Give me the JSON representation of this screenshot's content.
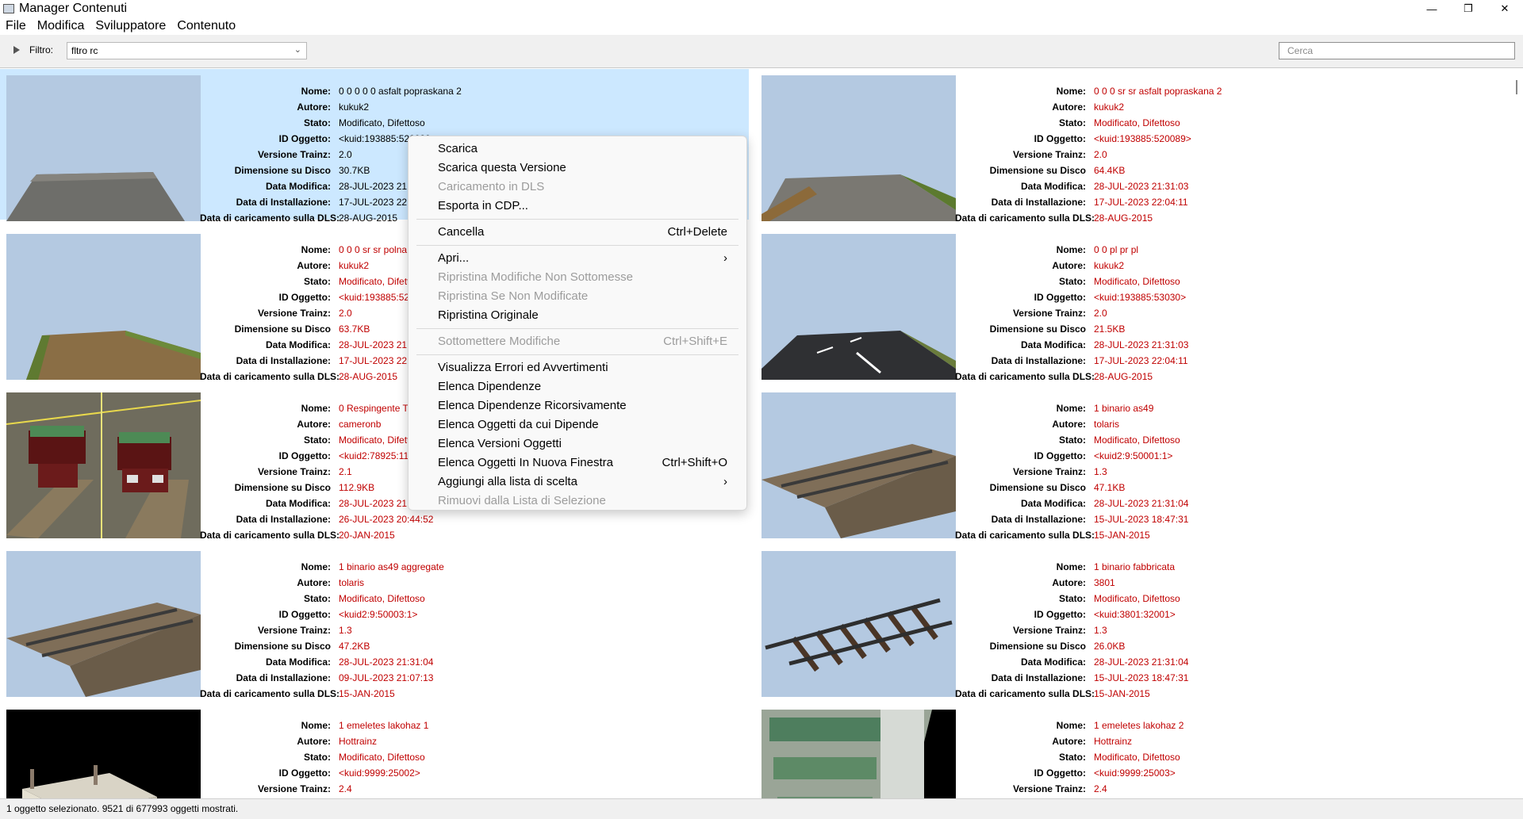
{
  "window": {
    "title": "Manager Contenuti",
    "min_label": "—",
    "max_label": "❐",
    "close_label": "✕"
  },
  "menubar": [
    "File",
    "Modifica",
    "Sviluppatore",
    "Contenuto"
  ],
  "toolbar": {
    "filter_label": "Filtro:",
    "filter_value": "fltro rc",
    "search_placeholder": "Cerca"
  },
  "labels": {
    "nome": "Nome:",
    "autore": "Autore:",
    "stato": "Stato:",
    "id": "ID Oggetto:",
    "versione": "Versione Trainz:",
    "dimensione": "Dimensione su Disco",
    "modifica": "Data Modifica:",
    "installazione": "Data di Installazione:",
    "dls": "Data di caricamento sulla DLS:"
  },
  "items": [
    {
      "nome": "0 0 0 0 0 asfalt popraskana 2",
      "autore": "kukuk2",
      "stato": "Modificato, Difettoso",
      "id": "<kuid:193885:520089>",
      "versione": "2.0",
      "dimensione": "30.7KB",
      "modifica": "28-JUL-2023 21:31:03",
      "installazione": "17-JUL-2023 22:04:11",
      "dls": "28-AUG-2015",
      "thumb": "road-gray",
      "selected": true
    },
    {
      "nome": "0 0 0 sr sr asfalt popraskana 2",
      "autore": "kukuk2",
      "stato": "Modificato, Difettoso",
      "id": "<kuid:193885:520089>",
      "versione": "2.0",
      "dimensione": "64.4KB",
      "modifica": "28-JUL-2023 21:31:03",
      "installazione": "17-JUL-2023 22:04:11",
      "dls": "28-AUG-2015",
      "thumb": "road-edge"
    },
    {
      "nome": "0 0 0 sr sr polna 2",
      "autore": "kukuk2",
      "stato": "Modificato, Difettoso",
      "id": "<kuid:193885:520089>",
      "versione": "2.0",
      "dimensione": "63.7KB",
      "modifica": "28-JUL-2023 21:31:03",
      "installazione": "17-JUL-2023 22:04:11",
      "dls": "28-AUG-2015",
      "thumb": "dirt"
    },
    {
      "nome": "0 0 pl pr pl",
      "autore": "kukuk2",
      "stato": "Modificato, Difettoso",
      "id": "<kuid:193885:53030>",
      "versione": "2.0",
      "dimensione": "21.5KB",
      "modifica": "28-JUL-2023 21:31:03",
      "installazione": "17-JUL-2023 22:04:11",
      "dls": "28-AUG-2015",
      "thumb": "asphalt"
    },
    {
      "nome": "0 Respingente TT",
      "autore": "cameronb",
      "stato": "Modificato, Difettoso",
      "id": "<kuid2:78925:11000:1>",
      "versione": "2.1",
      "dimensione": "112.9KB",
      "modifica": "28-JUL-2023 21:31:04",
      "installazione": "26-JUL-2023 20:44:52",
      "dls": "20-JAN-2015",
      "thumb": "wagons"
    },
    {
      "nome": "1 binario as49",
      "autore": "tolaris",
      "stato": "Modificato, Difettoso",
      "id": "<kuid2:9:50001:1>",
      "versione": "1.3",
      "dimensione": "47.1KB",
      "modifica": "28-JUL-2023 21:31:04",
      "installazione": "15-JUL-2023 18:47:31",
      "dls": "15-JAN-2015",
      "thumb": "track"
    },
    {
      "nome": "1 binario as49 aggregate",
      "autore": "tolaris",
      "stato": "Modificato, Difettoso",
      "id": "<kuid2:9:50003:1>",
      "versione": "1.3",
      "dimensione": "47.2KB",
      "modifica": "28-JUL-2023 21:31:04",
      "installazione": "09-JUL-2023 21:07:13",
      "dls": "15-JAN-2015",
      "thumb": "track"
    },
    {
      "nome": "1 binario fabbricata",
      "autore": "3801",
      "stato": "Modificato, Difettoso",
      "id": "<kuid:3801:32001>",
      "versione": "1.3",
      "dimensione": "26.0KB",
      "modifica": "28-JUL-2023 21:31:04",
      "installazione": "15-JUL-2023 18:47:31",
      "dls": "15-JAN-2015",
      "thumb": "sleepers"
    },
    {
      "nome": "1 emeletes lakohaz 1",
      "autore": "Hottrainz",
      "stato": "Modificato, Difettoso",
      "id": "<kuid:9999:25002>",
      "versione": "2.4",
      "dimensione": "",
      "modifica": "",
      "installazione": "",
      "dls": "",
      "thumb": "house-dark"
    },
    {
      "nome": "1 emeletes lakohaz 2",
      "autore": "Hottrainz",
      "stato": "Modificato, Difettoso",
      "id": "<kuid:9999:25003>",
      "versione": "2.4",
      "dimensione": "",
      "modifica": "",
      "installazione": "",
      "dls": "",
      "thumb": "house-wall"
    }
  ],
  "context_menu": [
    {
      "label": "Scarica",
      "shortcut": "",
      "disabled": false
    },
    {
      "label": "Scarica questa Versione",
      "shortcut": "",
      "disabled": false
    },
    {
      "label": "Caricamento in DLS",
      "shortcut": "",
      "disabled": true
    },
    {
      "label": "Esporta in CDP...",
      "shortcut": "",
      "disabled": false
    },
    {
      "sep": true
    },
    {
      "label": "Cancella",
      "shortcut": "Ctrl+Delete",
      "disabled": false
    },
    {
      "sep": true
    },
    {
      "label": "Apri...",
      "shortcut": "›",
      "disabled": false
    },
    {
      "label": "Ripristina Modifiche Non Sottomesse",
      "shortcut": "",
      "disabled": true
    },
    {
      "label": "Ripristina Se Non Modificate",
      "shortcut": "",
      "disabled": true
    },
    {
      "label": "Ripristina Originale",
      "shortcut": "",
      "disabled": false
    },
    {
      "sep": true
    },
    {
      "label": "Sottomettere Modifiche",
      "shortcut": "Ctrl+Shift+E",
      "disabled": true
    },
    {
      "sep": true
    },
    {
      "label": "Visualizza Errori ed Avvertimenti",
      "shortcut": "",
      "disabled": false
    },
    {
      "label": "Elenca Dipendenze",
      "shortcut": "",
      "disabled": false
    },
    {
      "label": "Elenca Dipendenze Ricorsivamente",
      "shortcut": "",
      "disabled": false
    },
    {
      "label": "Elenca Oggetti da cui Dipende",
      "shortcut": "",
      "disabled": false
    },
    {
      "label": "Elenca Versioni Oggetti",
      "shortcut": "",
      "disabled": false
    },
    {
      "label": "Elenca Oggetti In Nuova Finestra",
      "shortcut": "Ctrl+Shift+O",
      "disabled": false
    },
    {
      "label": "Aggiungi alla lista di scelta",
      "shortcut": "›",
      "disabled": false
    },
    {
      "label": "Rimuovi dalla Lista di Selezione",
      "shortcut": "",
      "disabled": true
    }
  ],
  "status": "1 oggetto selezionato. 9521 di 677993 oggetti mostrati."
}
